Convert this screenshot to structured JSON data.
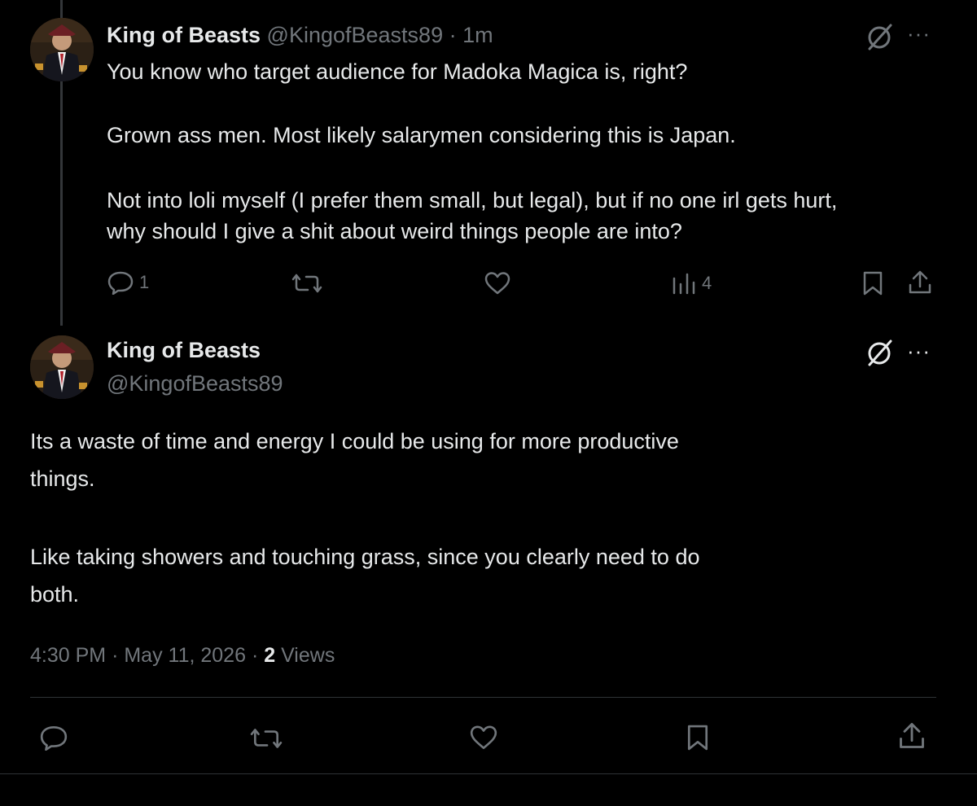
{
  "reply": {
    "display_name": "King of Beasts",
    "handle": "@KingofBeasts89",
    "separator": "·",
    "time": "1m",
    "body": [
      "You know who target audience for Madoka Magica is, right?",
      "Grown ass men. Most likely salarymen considering this is Japan.",
      "Not into loli myself (I prefer them small, but legal), but if no one irl gets hurt,",
      "why should I give a shit about weird things people are into?"
    ],
    "stats": {
      "replies": "1",
      "views": "4"
    },
    "menu_label": "···"
  },
  "main": {
    "display_name": "King of Beasts",
    "handle": "@KingofBeasts89",
    "menu_label": "···",
    "body": [
      "Its a waste of time and energy I could be using for more productive",
      "things.",
      "Like taking showers and touching grass, since you clearly need to do",
      "both."
    ],
    "meta": {
      "time": "4:30 PM",
      "sep1": "·",
      "date": "May 11, 2026",
      "sep2": "·",
      "views_count": "2",
      "views_label": "Views"
    }
  },
  "icons": {
    "reply": "speech-bubble-icon",
    "repost": "repost-arrows-icon",
    "like": "heart-icon",
    "views": "bar-chart-icon",
    "bookmark": "bookmark-icon",
    "share": "share-upload-icon",
    "grok": "slashed-circle-icon",
    "more": "more-dots-icon"
  },
  "colors": {
    "background": "#000000",
    "text": "#e7e9ea",
    "muted": "#71767b",
    "divider": "#2f3336"
  }
}
